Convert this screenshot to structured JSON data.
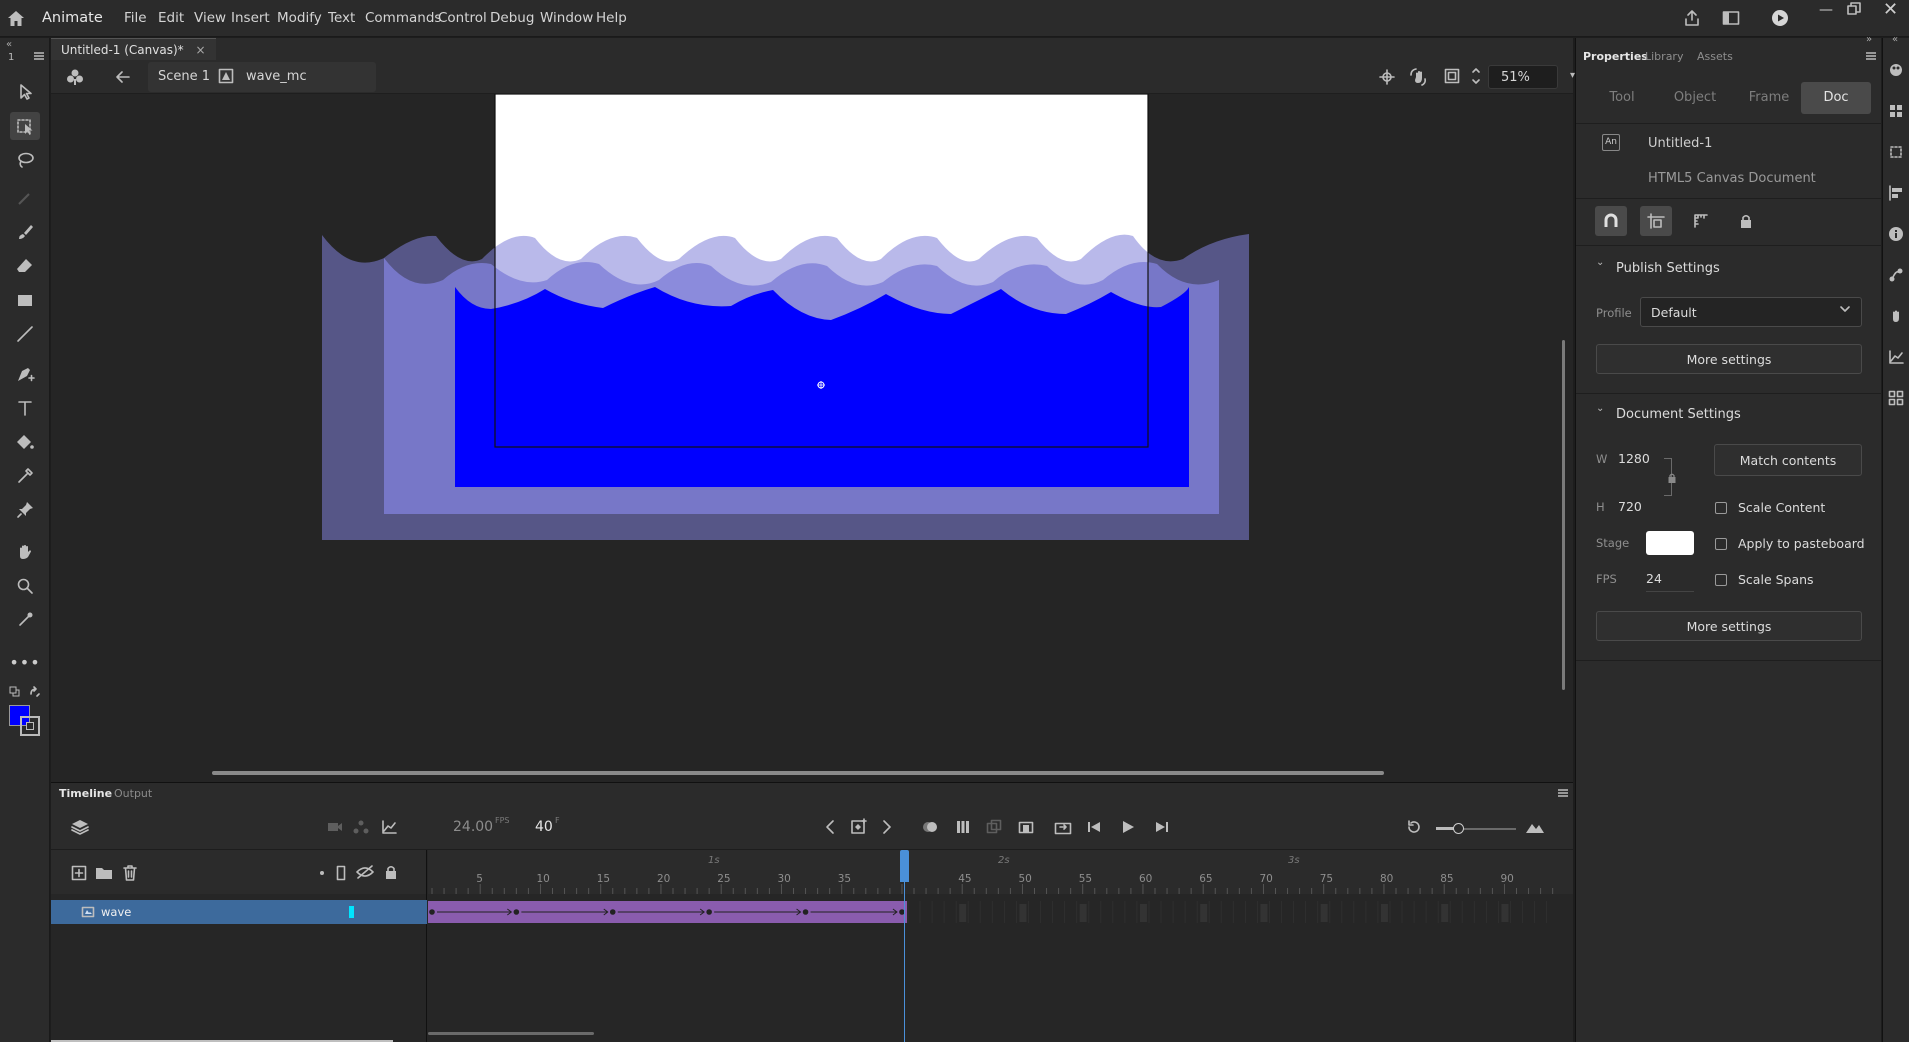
{
  "app": {
    "name": "Animate"
  },
  "menu": [
    "File",
    "Edit",
    "View",
    "Insert",
    "Modify",
    "Text",
    "Commands",
    "Control",
    "Debug",
    "Window",
    "Help"
  ],
  "document": {
    "tab_label": "Untitled-1 (Canvas)*",
    "close": "×"
  },
  "editbar": {
    "scene": "Scene 1",
    "symbol": "wave_mc",
    "zoom": "51%"
  },
  "toolbar": {
    "frame_indicator": "1",
    "fill_color": "#0000ff",
    "stroke_color": "#000000"
  },
  "stage": {
    "background": "#ffffff",
    "water_color": "#0000ff",
    "wave_overlay_color": "#8080d8"
  },
  "timeline": {
    "tabs": [
      "Timeline",
      "Output"
    ],
    "fps": "24.00",
    "fps_unit": "FPS",
    "current_frame": "40",
    "frame_unit": "F",
    "seconds": [
      "1s",
      "2s",
      "3s"
    ],
    "frame_ticks": [
      "5",
      "10",
      "15",
      "20",
      "25",
      "30",
      "35",
      "45",
      "50",
      "55",
      "60",
      "65",
      "70",
      "75",
      "80",
      "85",
      "90"
    ],
    "layers": [
      {
        "name": "wave",
        "color": "#00e5ff"
      }
    ],
    "span_color": "#8a5cae"
  },
  "properties": {
    "tabs": [
      "Properties",
      "Library",
      "Assets"
    ],
    "subtabs": [
      "Tool",
      "Object",
      "Frame",
      "Doc"
    ],
    "active_subtab": "Doc",
    "doc_name": "Untitled-1",
    "doc_type": "HTML5 Canvas Document",
    "publish": {
      "header": "Publish Settings",
      "profile_label": "Profile",
      "profile_value": "Default",
      "more_settings": "More settings"
    },
    "document_settings": {
      "header": "Document Settings",
      "w_label": "W",
      "w_value": "1280",
      "h_label": "H",
      "h_value": "720",
      "match_contents": "Match contents",
      "scale_content": "Scale Content",
      "stage_label": "Stage",
      "stage_color": "#ffffff",
      "apply_pasteboard": "Apply to pasteboard",
      "fps_label": "FPS",
      "fps_value": "24",
      "scale_spans": "Scale Spans",
      "more_settings": "More settings"
    }
  }
}
